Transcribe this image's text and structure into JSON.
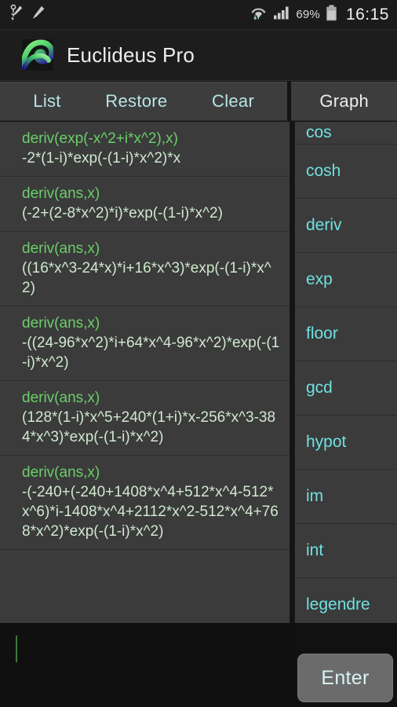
{
  "status_bar": {
    "left_icons": [
      "stylus-detach-icon",
      "pen-icon"
    ],
    "wifi_icon": "wifi-icon",
    "signal_icon": "cellular-signal-icon",
    "battery_percent": "69%",
    "battery_icon": "battery-icon",
    "clock": "16:15"
  },
  "title_bar": {
    "logo_icon": "wave-logo-icon",
    "app_title": "Euclideus Pro"
  },
  "toolbar": {
    "list_label": "List",
    "restore_label": "Restore",
    "clear_label": "Clear",
    "graph_label": "Graph",
    "accent_color": "#b9e4e4"
  },
  "history": {
    "query_color": "#6ace6a",
    "result_color": "#cfe8cf",
    "items": [
      {
        "query": "deriv(exp(-x^2+i*x^2),x)",
        "result": "-2*(1-i)*exp(-(1-i)*x^2)*x"
      },
      {
        "query": "deriv(ans,x)",
        "result": "(-2+(2-8*x^2)*i)*exp(-(1-i)*x^2)"
      },
      {
        "query": "deriv(ans,x)",
        "result": "((16*x^3-24*x)*i+16*x^3)*exp(-(1-i)*x^2)"
      },
      {
        "query": "deriv(ans,x)",
        "result": "-((24-96*x^2)*i+64*x^4-96*x^2)*exp(-(1-i)*x^2)"
      },
      {
        "query": "deriv(ans,x)",
        "result": "(128*(1-i)*x^5+240*(1+i)*x-256*x^3-384*x^3)*exp(-(1-i)*x^2)"
      },
      {
        "query": "deriv(ans,x)",
        "result": "-(-240+(-240+1408*x^4+512*x^4-512*x^6)*i-1408*x^4+2112*x^2-512*x^4+768*x^2)*exp(-(1-i)*x^2)"
      }
    ]
  },
  "function_panel": {
    "text_color": "#6fe0e0",
    "items": [
      "cos",
      "cosh",
      "deriv",
      "exp",
      "floor",
      "gcd",
      "hypot",
      "im",
      "int",
      "legendre"
    ]
  },
  "input": {
    "value": "",
    "caret_visible": true
  },
  "enter_button": {
    "label": "Enter"
  }
}
